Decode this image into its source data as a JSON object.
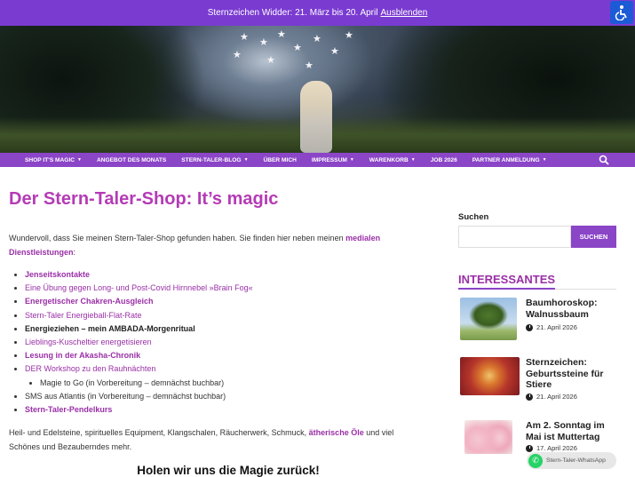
{
  "topbar": {
    "message": "Sternzeichen Widder: 21. März bis 20. April",
    "dismiss_label": "Ausblenden"
  },
  "nav": {
    "items": [
      {
        "label": "Shop it's magic",
        "dropdown": true
      },
      {
        "label": "Angebot des Monats",
        "dropdown": false
      },
      {
        "label": "Stern-Taler-Blog",
        "dropdown": true
      },
      {
        "label": "Über mich",
        "dropdown": false
      },
      {
        "label": "Impressum",
        "dropdown": true
      },
      {
        "label": "Warenkorb",
        "dropdown": true
      },
      {
        "label": "Job 2026",
        "dropdown": false
      },
      {
        "label": "Partner Anmeldung",
        "dropdown": true
      }
    ]
  },
  "main": {
    "title": "Der Stern-Taler-Shop: It’s magic",
    "intro_text": "Wundervoll, dass Sie meinen Stern-Taler-Shop gefunden haben. Sie finden hier neben meinen ",
    "intro_link": "medialen Dienstleistungen",
    "intro_end": ":",
    "services": [
      "Jenseitskontakte",
      "Eine Übung gegen Long- und Post-Covid Hirnnebel »Brain Fog«",
      "Energetischer Chakren-Ausgleich",
      "Stern-Taler Energieball-Flat-Rate",
      "Energieziehen – mein AMBADA-Morgenritual",
      "Lieblings-Kuscheltier energetisieren",
      "Lesung in der Akasha-Chronik",
      "DER Workshop zu den Rauhnächten",
      "Magie to Go (in Vorbereitung – demnächst buchbar)",
      "SMS aus Atlantis (in Vorbereitung – demnächst buchbar)",
      "Stern-Taler-Pendelkurs"
    ],
    "after_text": "Heil- und Edelsteine, spirituelles Equipment, Klangschalen, Räucherwerk, Schmuck, ",
    "after_link": "ätherische Öle",
    "after_end": " und viel Schönes und Bezauberndes mehr.",
    "subheading": "Holen wir uns die Magie zurück!"
  },
  "sidebar": {
    "search_label": "Suchen",
    "search_value": "",
    "search_button": "Suchen",
    "widget_title": "Interessantes",
    "posts": [
      {
        "title": "Baumhoroskop: Walnussbaum",
        "date": "21. April 2026"
      },
      {
        "title": "Sternzeichen: Geburtssteine für Stiere",
        "date": "21. April 2026"
      },
      {
        "title": "Am 2. Sonntag im Mai ist Muttertag",
        "date": "17. April 2026"
      }
    ]
  },
  "whatsapp": {
    "label": "Stern-Taler-WhatsApp"
  },
  "colors": {
    "accent": "#8b45c7",
    "link": "#9a2fa7",
    "title": "#b43bb5",
    "topbar": "#7a3bd1"
  }
}
